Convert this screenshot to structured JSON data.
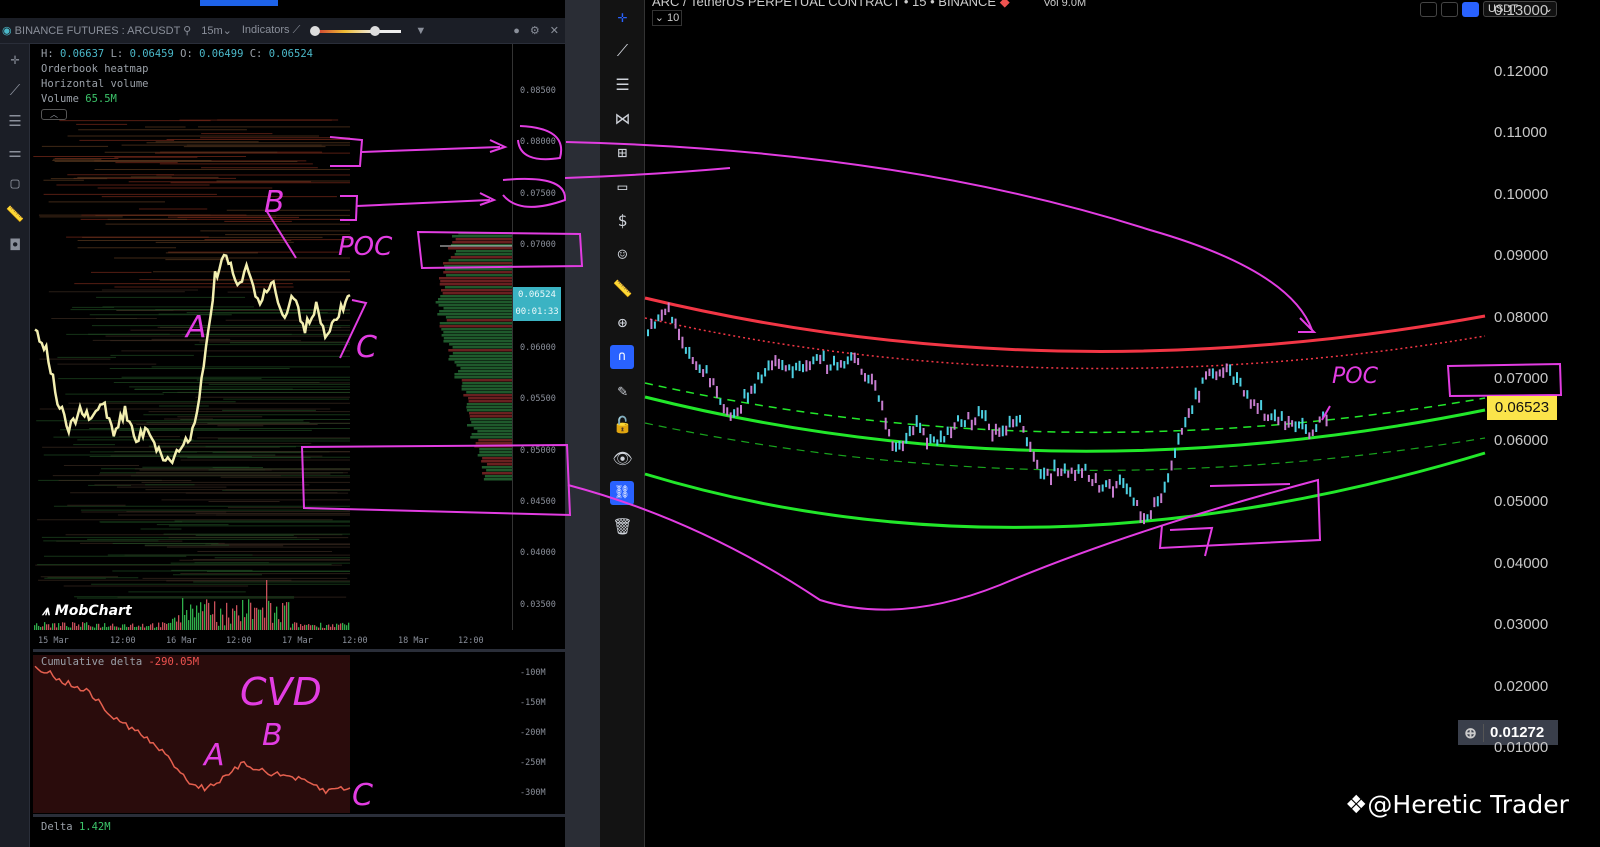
{
  "left_panel": {
    "title": "BINANCE FUTURES : ARCUSDT",
    "interval": "15m",
    "indicators_label": "Indicators",
    "ohlc": {
      "h_label": "H:",
      "h": "0.06637",
      "l_label": "L:",
      "l": "0.06459",
      "o_label": "O:",
      "o": "0.06499",
      "c_label": "C:",
      "c": "0.06524"
    },
    "layers": [
      "Orderbook heatmap",
      "Horizontal volume"
    ],
    "volume_label": "Volume",
    "volume_value": "65.5M",
    "price_axis": [
      "0.08500",
      "0.08000",
      "0.07500",
      "0.07000",
      "0.06000",
      "0.05500",
      "0.05000",
      "0.04500",
      "0.04000",
      "0.03500"
    ],
    "current_price": "0.06524",
    "countdown": "00:01:33",
    "time_axis": [
      "15 Mar",
      "12:00",
      "16 Mar",
      "12:00",
      "17 Mar",
      "12:00",
      "18 Mar",
      "12:00"
    ],
    "logo": "MobChart",
    "cvd_label": "Cumulative delta",
    "cvd_value": "-290.05M",
    "cvd_axis": [
      "-100M",
      "-150M",
      "-200M",
      "-250M",
      "-300M"
    ],
    "delta_label": "Delta",
    "delta_value": "1.42M",
    "price_series": [
      0.062,
      0.06,
      0.055,
      0.052,
      0.054,
      0.053,
      0.055,
      0.052,
      0.054,
      0.051,
      0.0525,
      0.05,
      0.049,
      0.0505,
      0.052,
      0.058,
      0.067,
      0.069,
      0.066,
      0.068,
      0.064,
      0.067,
      0.063,
      0.065,
      0.062,
      0.064,
      0.061,
      0.0635,
      0.06524
    ],
    "cvd_series": [
      -88,
      -95,
      -110,
      -118,
      -125,
      -140,
      -165,
      -180,
      -190,
      -205,
      -220,
      -240,
      -262,
      -285,
      -290,
      -280,
      -270,
      -250,
      -255,
      -262,
      -268,
      -270,
      -278,
      -285,
      -296,
      -290,
      -290
    ]
  },
  "right_panel": {
    "title": "ARC / TetherUS PERPETUAL CONTRACT • 15 • BINANCE",
    "volume": "Vol 9.0M",
    "collapse_label": "10",
    "currency": "USDT",
    "price_axis": [
      "0.13000",
      "0.12000",
      "0.11000",
      "0.10000",
      "0.09000",
      "0.08000",
      "0.07000",
      "0.06000",
      "0.05000",
      "0.04000",
      "0.03000",
      "0.02000",
      "0.01000"
    ],
    "current_price": "0.06523",
    "crosshair_price": "0.01272",
    "price_series": [
      0.078,
      0.0815,
      0.074,
      0.07,
      0.064,
      0.068,
      0.073,
      0.071,
      0.0735,
      0.072,
      0.0735,
      0.069,
      0.058,
      0.062,
      0.059,
      0.063,
      0.064,
      0.061,
      0.063,
      0.0545,
      0.055,
      0.0555,
      0.0525,
      0.053,
      0.0475,
      0.052,
      0.063,
      0.0705,
      0.0715,
      0.067,
      0.064,
      0.063,
      0.061,
      0.0652
    ],
    "colors": {
      "candle_up": "#4dd0e1",
      "candle_down": "#c77dcf",
      "band_red": "#f23645",
      "band_green": "#22e82a",
      "price_tag": "#fbe44a"
    }
  },
  "annotations": {
    "a": "A",
    "b": "B",
    "c": "C",
    "poc_left": "POC",
    "poc_right": "POC",
    "cvd": "CVD",
    "cvd_a": "A",
    "cvd_b": "B",
    "cvd_c": "C",
    "color": "#e23de2"
  },
  "watermark": "@Heretic Trader"
}
